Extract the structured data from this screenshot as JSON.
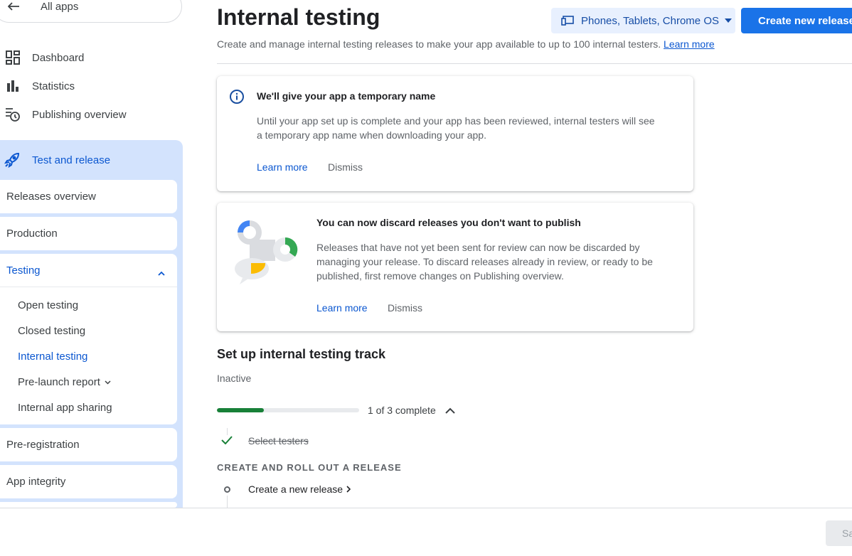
{
  "sidebar": {
    "all_apps": "All apps",
    "items": [
      {
        "label": "Dashboard",
        "icon": "dashboard-icon"
      },
      {
        "label": "Statistics",
        "icon": "bar-chart-icon"
      },
      {
        "label": "Publishing overview",
        "icon": "publishing-overview-icon"
      }
    ],
    "section": {
      "label": "Test and release",
      "icon": "rocket-icon",
      "groups": {
        "releases_overview": "Releases overview",
        "production": "Production",
        "testing": "Testing",
        "testing_items": [
          "Open testing",
          "Closed testing",
          "Internal testing",
          "Pre-launch report",
          "Internal app sharing"
        ],
        "pre_registration": "Pre-registration",
        "app_integrity": "App integrity"
      }
    }
  },
  "header": {
    "title": "Internal testing",
    "subtitle": "Create and manage internal testing releases to make your app available to up to 100 internal testers.",
    "learn_more": "Learn more",
    "device_selector": "Phones, Tablets, Chrome OS",
    "create_button": "Create new release"
  },
  "cards": {
    "temp_name": {
      "title": "We'll give your app a temporary name",
      "body": "Until your app set up is complete and your app has been reviewed, internal testers will see a temporary app name when downloading your app.",
      "learn_more": "Learn more",
      "dismiss": "Dismiss"
    },
    "discard": {
      "title": "You can now discard releases you don't want to publish",
      "body": "Releases that have not yet been sent for review can now be discarded by managing your release. To discard releases already in review, or ready to be published, first remove changes on Publishing overview.",
      "learn_more": "Learn more",
      "dismiss": "Dismiss"
    }
  },
  "track": {
    "title": "Set up internal testing track",
    "status": "Inactive",
    "progress_fraction": 0.33,
    "progress_label": "1 of 3 complete",
    "step_done": "Select testers",
    "step_heading": "CREATE AND ROLL OUT A RELEASE",
    "step_next": "Create a new release"
  },
  "footer": {
    "save_label": "Sa"
  },
  "colors": {
    "accent": "#1a73e8",
    "active_text": "#0b57d0",
    "section_bg": "#d3e3fd",
    "progress": "#188038"
  }
}
